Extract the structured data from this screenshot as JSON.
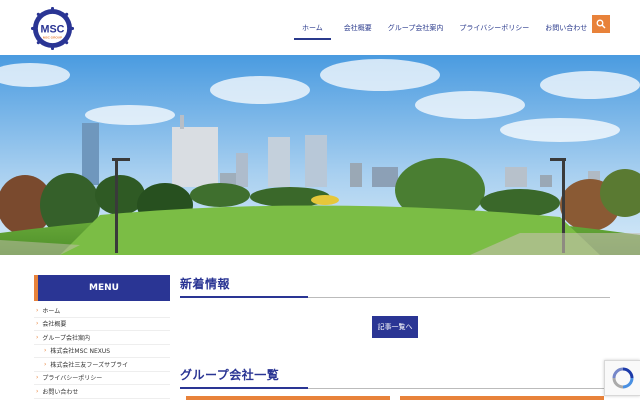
{
  "header": {
    "logo_text": "MSC",
    "logo_subtext": "MSC GROUP",
    "nav": [
      {
        "label": "ホーム",
        "active": true
      },
      {
        "label": "会社概要",
        "active": false
      },
      {
        "label": "グループ会社案内",
        "active": false
      },
      {
        "label": "プライバシーポリシー",
        "active": false
      },
      {
        "label": "お問い合わせ",
        "active": false
      }
    ],
    "search_icon": "search-icon"
  },
  "sidebar": {
    "title": "MENU",
    "items": [
      {
        "label": "ホーム",
        "sub": false
      },
      {
        "label": "会社概要",
        "sub": false
      },
      {
        "label": "グループ会社案内",
        "sub": false
      },
      {
        "label": "株式会社MSC NEXUS",
        "sub": true
      },
      {
        "label": "株式会社三友フーズサプライ",
        "sub": true
      },
      {
        "label": "プライバシーポリシー",
        "sub": false
      },
      {
        "label": "お問い合わせ",
        "sub": false
      }
    ]
  },
  "main": {
    "news_title": "新着情報",
    "news_button": "記事一覧へ",
    "group_title": "グループ会社一覧"
  },
  "colors": {
    "brand_blue": "#2a3594",
    "accent_orange": "#e8823a"
  }
}
